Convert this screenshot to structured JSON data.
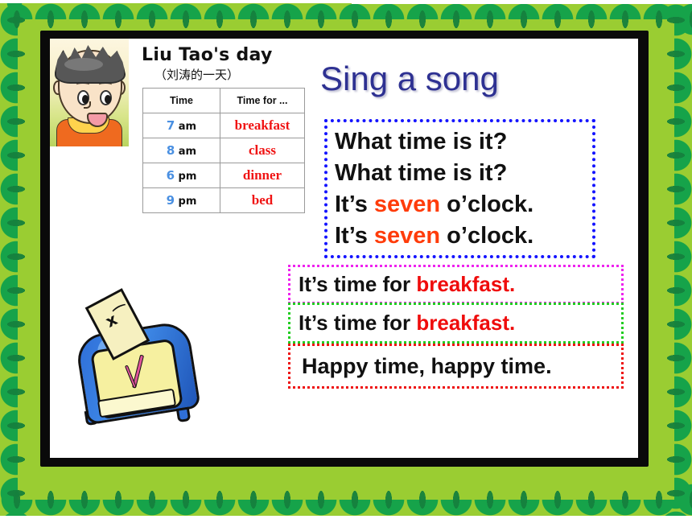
{
  "slide": {
    "headline": "Sing a song",
    "headline_color": "#2e3192"
  },
  "schedule": {
    "title": "Liu Tao's day",
    "subtitle": "（刘涛的一天）",
    "columns": [
      "Time",
      "Time for ..."
    ],
    "rows": [
      {
        "hour": "7",
        "meridiem": "am",
        "activity": "breakfast"
      },
      {
        "hour": "8",
        "meridiem": "am",
        "activity": "class"
      },
      {
        "hour": "6",
        "meridiem": "pm",
        "activity": "dinner"
      },
      {
        "hour": "9",
        "meridiem": "pm",
        "activity": "bed"
      }
    ],
    "hour_color": "#4a90e2",
    "activity_color": "#f01414"
  },
  "song": {
    "verse_box": {
      "border_color": "#1414ff",
      "lines": [
        {
          "pre": "What time is it",
          "highlight": "",
          "post": "?"
        },
        {
          "pre": "What time is it",
          "highlight": "",
          "post": "?"
        },
        {
          "pre": "It’s ",
          "highlight": "seven",
          "post": " o’clock."
        },
        {
          "pre": "It’s ",
          "highlight": "seven",
          "post": " o’clock."
        }
      ],
      "highlight_color": "#ff3c0a"
    },
    "chorus_boxes": [
      {
        "border_color": "#ee22ee",
        "pre": "It’s time for ",
        "highlight": "breakfast.",
        "post": "",
        "highlight_color": "#ef0c0c"
      },
      {
        "border_color": "#22cc22",
        "pre": "It’s time for ",
        "highlight": "breakfast.",
        "post": "",
        "highlight_color": "#ef0c0c"
      },
      {
        "border_color": "#ee1111",
        "pre": "Happy time, happy time.",
        "highlight": "",
        "post": "",
        "highlight_color": "#ef0c0c"
      }
    ]
  },
  "illustrations": {
    "boy": "cartoon-boy-portrait",
    "clock": "blue-alarm-clock",
    "note_face": "x⁀"
  },
  "frame": {
    "border_style": "green-scalloped-border",
    "border_color": "#9ACD32",
    "border_accent_color": "#16a34a"
  }
}
